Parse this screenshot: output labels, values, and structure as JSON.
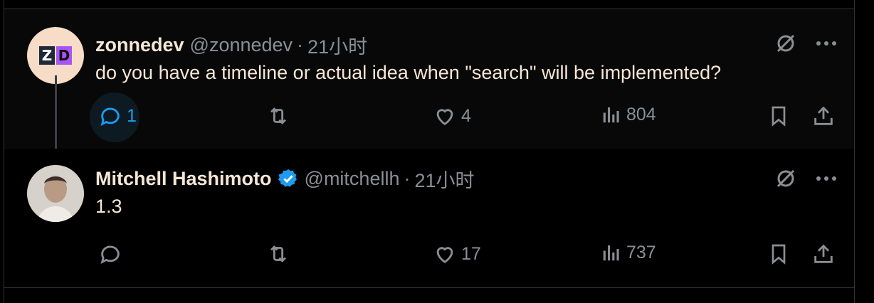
{
  "tweets": [
    {
      "avatar_text": {
        "left": "Z",
        "right": "D"
      },
      "display_name": "zonnedev",
      "handle": "@zonnedev",
      "separator": "·",
      "time": "21小时",
      "text": "do you have a timeline or actual idea when \"search\" will be implemented?",
      "reply_count": "1",
      "like_count": "4",
      "views_count": "804",
      "reply_active": true
    },
    {
      "display_name": "Mitchell Hashimoto",
      "handle": "@mitchellh",
      "separator": "·",
      "time": "21小时",
      "text": "1.3",
      "reply_count": "",
      "like_count": "17",
      "views_count": "737",
      "verified": true
    }
  ],
  "colors": {
    "background": "#000000",
    "text": "#f6e6d6",
    "muted": "#8b8f93",
    "accent": "#1d9bf0",
    "verified": "#1d9bf0"
  },
  "icons": [
    "grok-icon",
    "more-icon",
    "reply-icon",
    "repost-icon",
    "like-icon",
    "views-icon",
    "bookmark-icon",
    "share-icon",
    "verified-badge-icon"
  ]
}
